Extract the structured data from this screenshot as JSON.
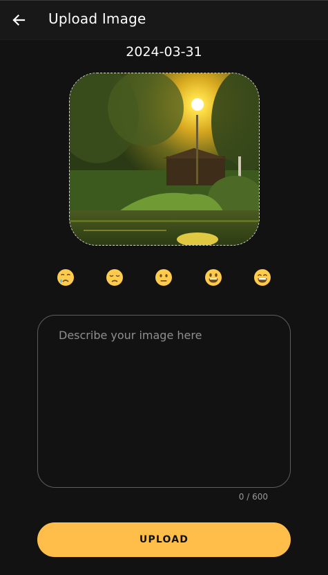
{
  "appbar": {
    "title": "Upload Image",
    "back_icon": "arrow-left-icon"
  },
  "date": "2024-03-31",
  "image": {
    "description": "sunset-over-pond-with-trees-and-house"
  },
  "moods": [
    {
      "name": "crying-face",
      "icon": "crying-face-icon"
    },
    {
      "name": "disappointed-face",
      "icon": "disappointed-face-icon"
    },
    {
      "name": "neutral-face",
      "icon": "neutral-face-icon"
    },
    {
      "name": "smiling-face",
      "icon": "grinning-face-icon"
    },
    {
      "name": "big-grin-face",
      "icon": "beaming-face-icon"
    }
  ],
  "description_field": {
    "placeholder": "Describe your image here",
    "value": "",
    "counter": "0 / 600"
  },
  "upload_button": {
    "label": "UPLOAD"
  },
  "colors": {
    "background": "#121212",
    "appbar": "#181818",
    "accent": "#ffbe4a",
    "emoji": "#ffcb4c"
  }
}
